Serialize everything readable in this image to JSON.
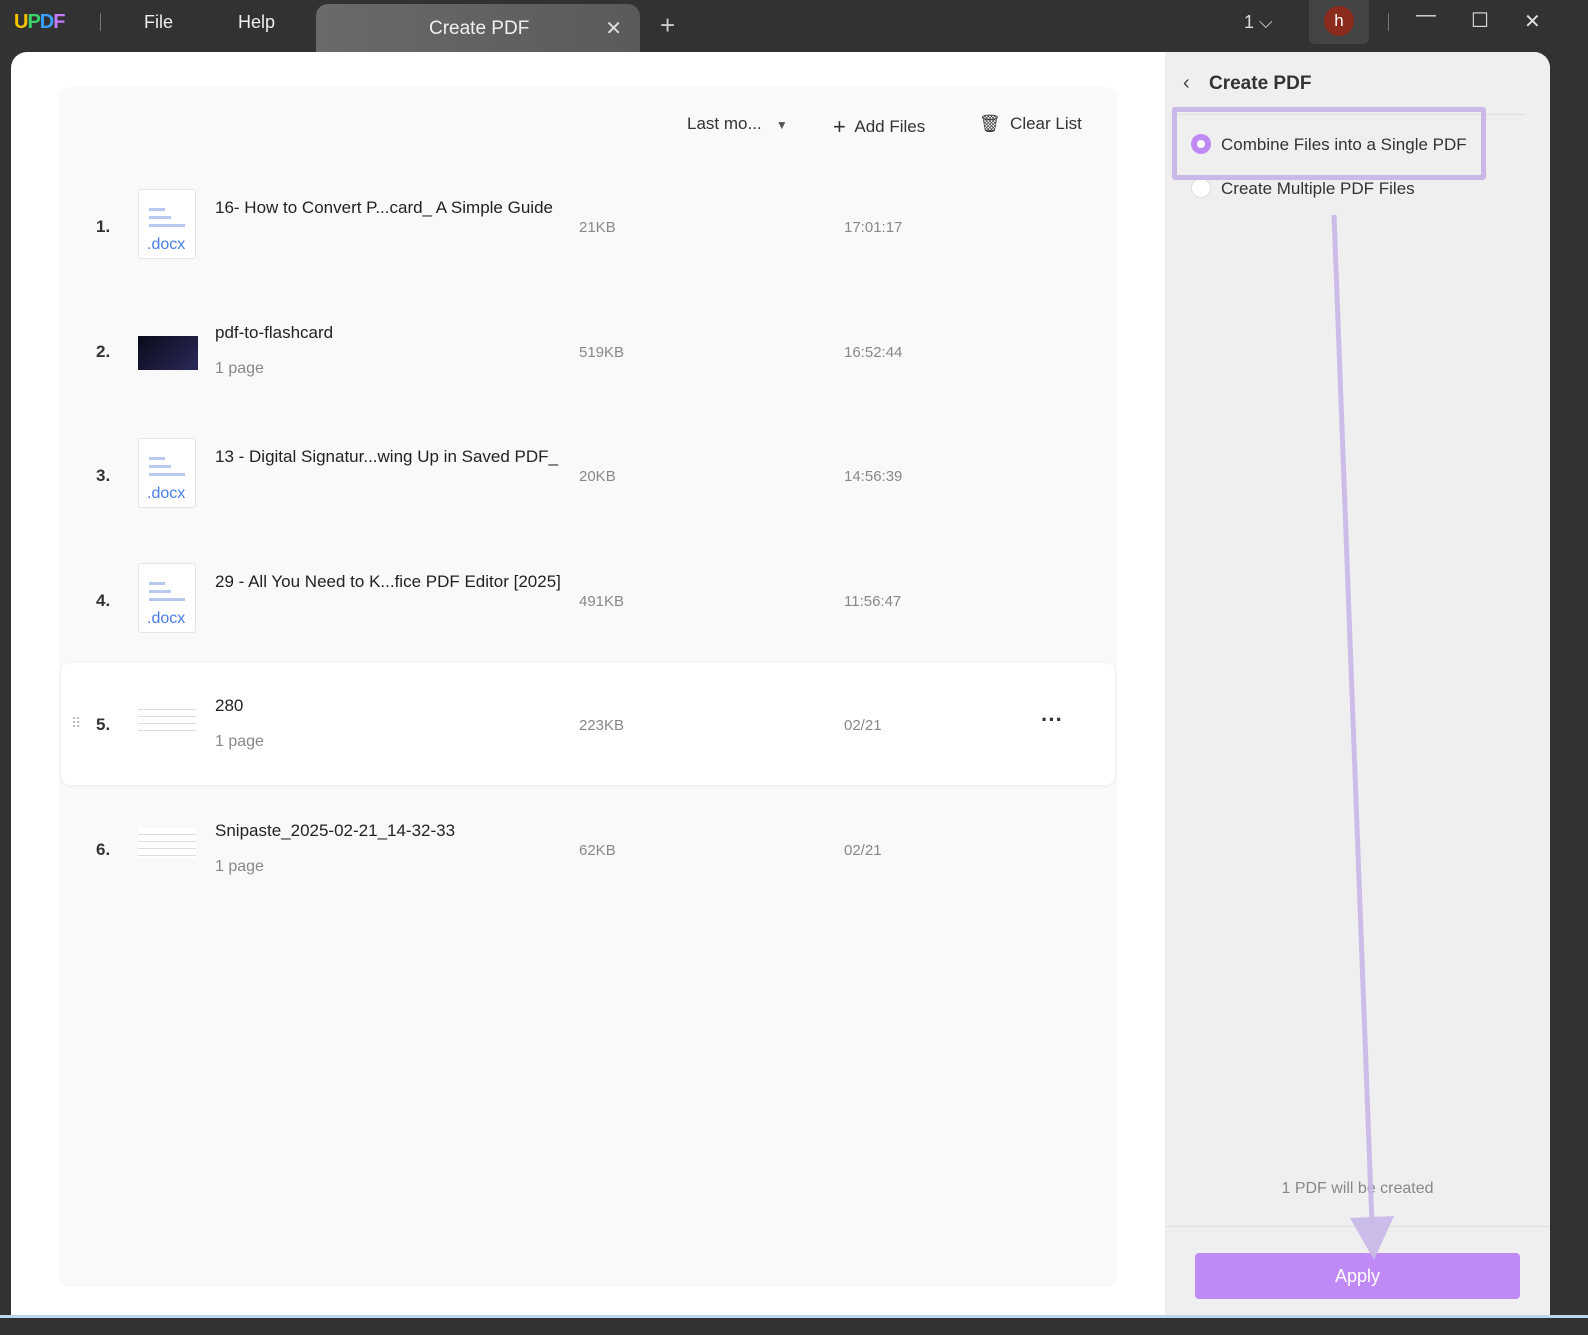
{
  "app": {
    "logo": "UPDF",
    "menu": [
      "File",
      "Help"
    ],
    "tab": "Create PDF",
    "page_count": "1",
    "avatar": "h"
  },
  "toolbar": {
    "sort": "Last mo...",
    "add_files": "Add Files",
    "clear_list": "Clear List"
  },
  "files": [
    {
      "num": "1.",
      "name": "16- How to Convert P...card_ A Simple Guide",
      "pages": "",
      "size": "21KB",
      "time": "17:01:17",
      "type": ".docx"
    },
    {
      "num": "2.",
      "name": "pdf-to-flashcard",
      "pages": "1 page",
      "size": "519KB",
      "time": "16:52:44",
      "type": "image"
    },
    {
      "num": "3.",
      "name": "13 - Digital Signatur...wing Up in Saved PDF_",
      "pages": "",
      "size": "20KB",
      "time": "14:56:39",
      "type": ".docx"
    },
    {
      "num": "4.",
      "name": "29 - All You Need to K...fice PDF Editor [2025]",
      "pages": "",
      "size": "491KB",
      "time": "11:56:47",
      "type": ".docx"
    },
    {
      "num": "5.",
      "name": "280",
      "pages": "1 page",
      "size": "223KB",
      "time": "02/21",
      "type": "image"
    },
    {
      "num": "6.",
      "name": "Snipaste_2025-02-21_14-32-33",
      "pages": "1 page",
      "size": "62KB",
      "time": "02/21",
      "type": "image"
    }
  ],
  "sidebar": {
    "title": "Create PDF",
    "options": [
      "Combine Files into a Single PDF",
      "Create Multiple PDF Files"
    ],
    "selected": 0,
    "note": "1 PDF will be created",
    "apply": "Apply"
  },
  "colors": {
    "accent": "#c08af6",
    "annotation": "#c9b8e8"
  }
}
